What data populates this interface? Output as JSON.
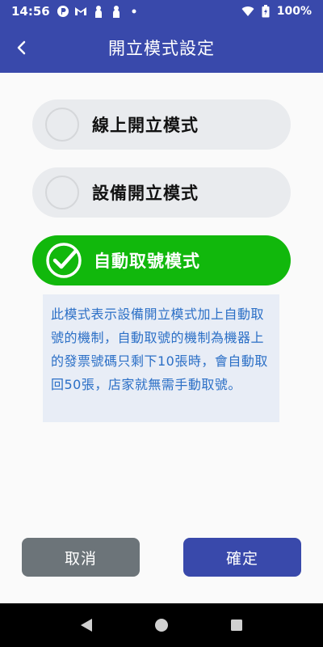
{
  "status_bar": {
    "time": "14:56",
    "battery_percent": "100%"
  },
  "header": {
    "title": "開立模式設定"
  },
  "modes": [
    {
      "label": "線上開立模式",
      "selected": false
    },
    {
      "label": "設備開立模式",
      "selected": false
    },
    {
      "label": "自動取號模式",
      "selected": true
    }
  ],
  "description": "此模式表示設備開立模式加上自動取號的機制，自動取號的機制為機器上的發票號碼只剩下10張時，會自動取回50張，店家就無需手動取號。",
  "buttons": {
    "cancel_label": "取消",
    "confirm_label": "確定"
  },
  "colors": {
    "primary": "#3949ab",
    "selected": "#11b80c",
    "cancel": "#6c7479",
    "description_text": "#2b6fc6",
    "description_bg": "#e8edf6"
  }
}
